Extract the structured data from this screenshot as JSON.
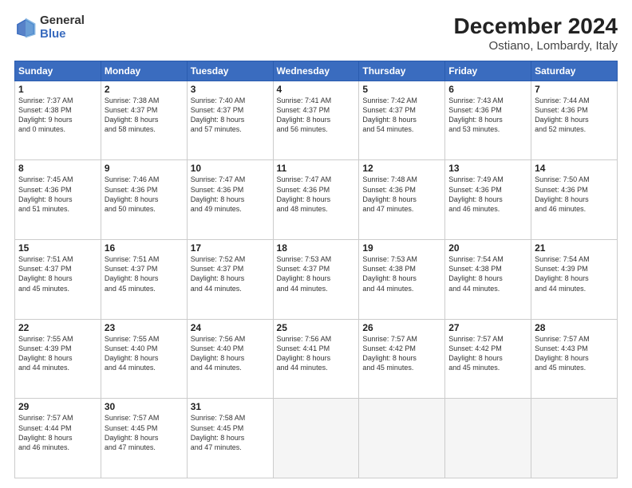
{
  "header": {
    "logo_line1": "General",
    "logo_line2": "Blue",
    "title": "December 2024",
    "subtitle": "Ostiano, Lombardy, Italy"
  },
  "weekdays": [
    "Sunday",
    "Monday",
    "Tuesday",
    "Wednesday",
    "Thursday",
    "Friday",
    "Saturday"
  ],
  "weeks": [
    [
      {
        "day": "1",
        "lines": [
          "Sunrise: 7:37 AM",
          "Sunset: 4:38 PM",
          "Daylight: 9 hours",
          "and 0 minutes."
        ]
      },
      {
        "day": "2",
        "lines": [
          "Sunrise: 7:38 AM",
          "Sunset: 4:37 PM",
          "Daylight: 8 hours",
          "and 58 minutes."
        ]
      },
      {
        "day": "3",
        "lines": [
          "Sunrise: 7:40 AM",
          "Sunset: 4:37 PM",
          "Daylight: 8 hours",
          "and 57 minutes."
        ]
      },
      {
        "day": "4",
        "lines": [
          "Sunrise: 7:41 AM",
          "Sunset: 4:37 PM",
          "Daylight: 8 hours",
          "and 56 minutes."
        ]
      },
      {
        "day": "5",
        "lines": [
          "Sunrise: 7:42 AM",
          "Sunset: 4:37 PM",
          "Daylight: 8 hours",
          "and 54 minutes."
        ]
      },
      {
        "day": "6",
        "lines": [
          "Sunrise: 7:43 AM",
          "Sunset: 4:36 PM",
          "Daylight: 8 hours",
          "and 53 minutes."
        ]
      },
      {
        "day": "7",
        "lines": [
          "Sunrise: 7:44 AM",
          "Sunset: 4:36 PM",
          "Daylight: 8 hours",
          "and 52 minutes."
        ]
      }
    ],
    [
      {
        "day": "8",
        "lines": [
          "Sunrise: 7:45 AM",
          "Sunset: 4:36 PM",
          "Daylight: 8 hours",
          "and 51 minutes."
        ]
      },
      {
        "day": "9",
        "lines": [
          "Sunrise: 7:46 AM",
          "Sunset: 4:36 PM",
          "Daylight: 8 hours",
          "and 50 minutes."
        ]
      },
      {
        "day": "10",
        "lines": [
          "Sunrise: 7:47 AM",
          "Sunset: 4:36 PM",
          "Daylight: 8 hours",
          "and 49 minutes."
        ]
      },
      {
        "day": "11",
        "lines": [
          "Sunrise: 7:47 AM",
          "Sunset: 4:36 PM",
          "Daylight: 8 hours",
          "and 48 minutes."
        ]
      },
      {
        "day": "12",
        "lines": [
          "Sunrise: 7:48 AM",
          "Sunset: 4:36 PM",
          "Daylight: 8 hours",
          "and 47 minutes."
        ]
      },
      {
        "day": "13",
        "lines": [
          "Sunrise: 7:49 AM",
          "Sunset: 4:36 PM",
          "Daylight: 8 hours",
          "and 46 minutes."
        ]
      },
      {
        "day": "14",
        "lines": [
          "Sunrise: 7:50 AM",
          "Sunset: 4:36 PM",
          "Daylight: 8 hours",
          "and 46 minutes."
        ]
      }
    ],
    [
      {
        "day": "15",
        "lines": [
          "Sunrise: 7:51 AM",
          "Sunset: 4:37 PM",
          "Daylight: 8 hours",
          "and 45 minutes."
        ]
      },
      {
        "day": "16",
        "lines": [
          "Sunrise: 7:51 AM",
          "Sunset: 4:37 PM",
          "Daylight: 8 hours",
          "and 45 minutes."
        ]
      },
      {
        "day": "17",
        "lines": [
          "Sunrise: 7:52 AM",
          "Sunset: 4:37 PM",
          "Daylight: 8 hours",
          "and 44 minutes."
        ]
      },
      {
        "day": "18",
        "lines": [
          "Sunrise: 7:53 AM",
          "Sunset: 4:37 PM",
          "Daylight: 8 hours",
          "and 44 minutes."
        ]
      },
      {
        "day": "19",
        "lines": [
          "Sunrise: 7:53 AM",
          "Sunset: 4:38 PM",
          "Daylight: 8 hours",
          "and 44 minutes."
        ]
      },
      {
        "day": "20",
        "lines": [
          "Sunrise: 7:54 AM",
          "Sunset: 4:38 PM",
          "Daylight: 8 hours",
          "and 44 minutes."
        ]
      },
      {
        "day": "21",
        "lines": [
          "Sunrise: 7:54 AM",
          "Sunset: 4:39 PM",
          "Daylight: 8 hours",
          "and 44 minutes."
        ]
      }
    ],
    [
      {
        "day": "22",
        "lines": [
          "Sunrise: 7:55 AM",
          "Sunset: 4:39 PM",
          "Daylight: 8 hours",
          "and 44 minutes."
        ]
      },
      {
        "day": "23",
        "lines": [
          "Sunrise: 7:55 AM",
          "Sunset: 4:40 PM",
          "Daylight: 8 hours",
          "and 44 minutes."
        ]
      },
      {
        "day": "24",
        "lines": [
          "Sunrise: 7:56 AM",
          "Sunset: 4:40 PM",
          "Daylight: 8 hours",
          "and 44 minutes."
        ]
      },
      {
        "day": "25",
        "lines": [
          "Sunrise: 7:56 AM",
          "Sunset: 4:41 PM",
          "Daylight: 8 hours",
          "and 44 minutes."
        ]
      },
      {
        "day": "26",
        "lines": [
          "Sunrise: 7:57 AM",
          "Sunset: 4:42 PM",
          "Daylight: 8 hours",
          "and 45 minutes."
        ]
      },
      {
        "day": "27",
        "lines": [
          "Sunrise: 7:57 AM",
          "Sunset: 4:42 PM",
          "Daylight: 8 hours",
          "and 45 minutes."
        ]
      },
      {
        "day": "28",
        "lines": [
          "Sunrise: 7:57 AM",
          "Sunset: 4:43 PM",
          "Daylight: 8 hours",
          "and 45 minutes."
        ]
      }
    ],
    [
      {
        "day": "29",
        "lines": [
          "Sunrise: 7:57 AM",
          "Sunset: 4:44 PM",
          "Daylight: 8 hours",
          "and 46 minutes."
        ]
      },
      {
        "day": "30",
        "lines": [
          "Sunrise: 7:57 AM",
          "Sunset: 4:45 PM",
          "Daylight: 8 hours",
          "and 47 minutes."
        ]
      },
      {
        "day": "31",
        "lines": [
          "Sunrise: 7:58 AM",
          "Sunset: 4:45 PM",
          "Daylight: 8 hours",
          "and 47 minutes."
        ]
      },
      null,
      null,
      null,
      null
    ]
  ]
}
